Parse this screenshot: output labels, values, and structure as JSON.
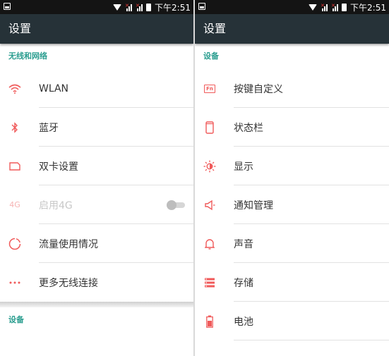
{
  "status": {
    "time": "下午2:51"
  },
  "colors": {
    "accent": "#F05A5A",
    "section": "#2A9D8F",
    "appbar": "#263238"
  },
  "left": {
    "title": "设置",
    "section_wireless": "无线和网络",
    "items": [
      {
        "label": "WLAN",
        "icon": "wifi-icon"
      },
      {
        "label": "蓝牙",
        "icon": "bluetooth-icon"
      },
      {
        "label": "双卡设置",
        "icon": "sim-card-icon"
      },
      {
        "label": "启用4G",
        "icon": "4g-icon",
        "icon_text": "4G",
        "disabled": true,
        "toggle": false
      },
      {
        "label": "流量使用情况",
        "icon": "data-usage-icon"
      },
      {
        "label": "更多无线连接",
        "icon": "more-icon"
      }
    ],
    "section_device": "设备"
  },
  "right": {
    "title": "设置",
    "section_device": "设备",
    "items": [
      {
        "label": "按键自定义",
        "icon": "fn-key-icon",
        "icon_text": "Fn"
      },
      {
        "label": "状态栏",
        "icon": "status-bar-icon"
      },
      {
        "label": "显示",
        "icon": "brightness-icon"
      },
      {
        "label": "通知管理",
        "icon": "notification-speaker-icon"
      },
      {
        "label": "声音",
        "icon": "bell-icon"
      },
      {
        "label": "存储",
        "icon": "storage-icon"
      },
      {
        "label": "电池",
        "icon": "battery-icon"
      }
    ]
  }
}
